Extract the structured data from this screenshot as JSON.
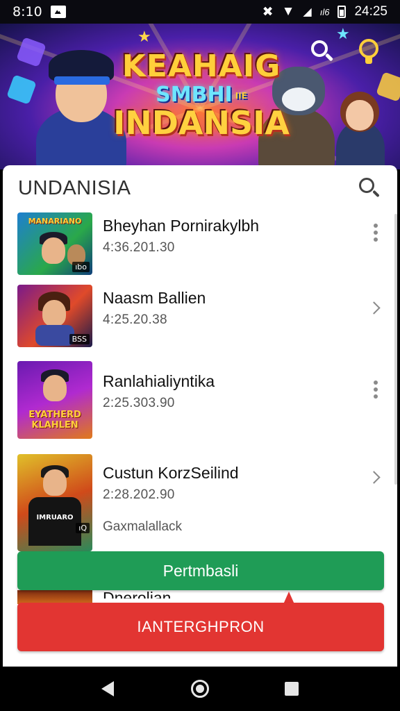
{
  "status_bar": {
    "time": "8:10",
    "network": "ıl6",
    "clock": "24:25"
  },
  "banner": {
    "title_line1": "KEAHAIG",
    "title_line2": "SMBHI",
    "title_line2_small": "IIE",
    "title_line3": "INDANSIA"
  },
  "header": {
    "title": "UNDANISIA"
  },
  "items": [
    {
      "title": "Bheyhan Pornirakylbh",
      "time": "4:36.201.30",
      "thumb_label": "MANARIANO",
      "badge": "ıbo",
      "action_icon": "more-vert-icon"
    },
    {
      "title": "Naasm Ballien",
      "time": "4:25.20.38",
      "badge": "BSS",
      "action_icon": "chevron-right-icon"
    },
    {
      "title": "Ranlahialiyntika",
      "time": "2:25.303.90",
      "thumb_label": "EYATHERD KLAHLEN",
      "badge": "",
      "action_icon": "more-vert-icon"
    },
    {
      "title": "Custun KorzSeilind",
      "time": "2:28.202.90",
      "subtitle": "Gaxmalallack",
      "thumb_label": "IMRUARO",
      "badge": "ıQ",
      "action_icon": "chevron-right-icon"
    },
    {
      "title": "Dnerolian"
    }
  ],
  "buttons": {
    "primary_label": "Pertmbasli",
    "danger_label": "IANTERGHPRON"
  },
  "colors": {
    "green": "#1f9c56",
    "red": "#e23532",
    "banner_accent": "#ffcf3a"
  }
}
